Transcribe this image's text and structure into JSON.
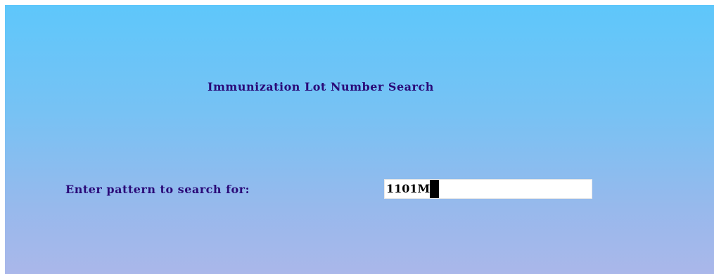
{
  "screen": {
    "title": "Immunization Lot Number Search"
  },
  "search": {
    "prompt": "Enter pattern to search for:",
    "value": "1101M"
  }
}
